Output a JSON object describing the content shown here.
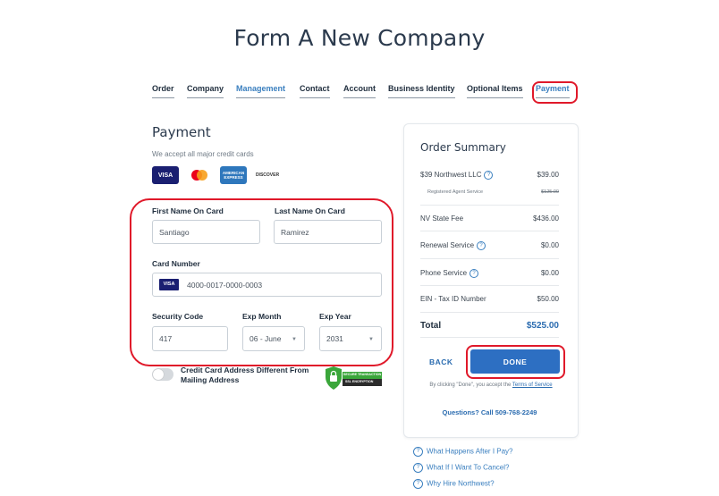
{
  "page_title": "Form A New Company",
  "tabs": [
    "Order",
    "Company",
    "Management",
    "Contact",
    "Account",
    "Business Identity",
    "Optional Items",
    "Payment"
  ],
  "payment": {
    "heading": "Payment",
    "accept_text": "We accept all major credit cards",
    "cards": [
      "VISA",
      "mastercard",
      "AMERICAN EXPRESS",
      "DISCOVER"
    ],
    "first_name_label": "First Name On Card",
    "first_name_value": "Santiago",
    "last_name_label": "Last Name On Card",
    "last_name_value": "Ramirez",
    "card_number_label": "Card Number",
    "card_number_value": "4000-0017-0000-0003",
    "card_badge": "VISA",
    "security_label": "Security Code",
    "security_value": "417",
    "exp_month_label": "Exp Month",
    "exp_month_value": "06 - June",
    "exp_year_label": "Exp Year",
    "exp_year_value": "2031",
    "toggle_label": "Credit Card Address Different From Mailing Address",
    "ssl_badge_line1": "SECURE TRANSACTION",
    "ssl_badge_line2": "SSL ENCRYPTION"
  },
  "summary": {
    "title": "Order Summary",
    "items": [
      {
        "label": "$39 Northwest LLC",
        "value": "$39.00",
        "help": true
      },
      {
        "label": "Registered Agent Service",
        "value": "$125.00",
        "sub": true,
        "strike": true
      },
      {
        "label": "NV State Fee",
        "value": "$436.00"
      },
      {
        "label": "Renewal Service",
        "value": "$0.00",
        "help": true
      },
      {
        "label": "Phone Service",
        "value": "$0.00",
        "help": true
      },
      {
        "label": "EIN - Tax ID Number",
        "value": "$50.00"
      }
    ],
    "total_label": "Total",
    "total_value": "$525.00",
    "back_label": "BACK",
    "done_label": "DONE",
    "terms_prefix": "By clicking \"Done\", you accept the",
    "terms_link": "Terms of Service",
    "questions": "Questions? Call 509-768-2249"
  },
  "faq": [
    "What Happens After I Pay?",
    "What If I Want To Cancel?",
    "Why Hire Northwest?"
  ],
  "colors": {
    "accent": "#2d6fc2",
    "highlight": "#e0192a",
    "link": "#3a7fbf"
  }
}
